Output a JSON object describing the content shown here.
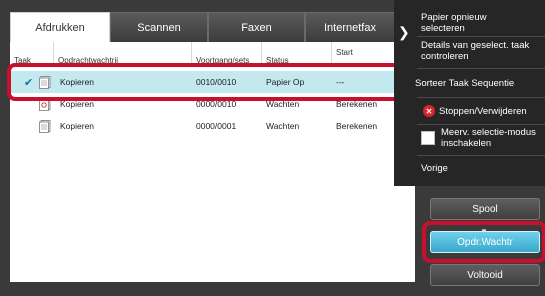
{
  "tabs": [
    {
      "label": "Afdrukken",
      "active": true
    },
    {
      "label": "Scannen",
      "active": false
    },
    {
      "label": "Faxen",
      "active": false
    },
    {
      "label": "Internetfax",
      "active": false
    }
  ],
  "table": {
    "columns": [
      "Taak",
      "Opdrachtwachtrij",
      "Voortgang/sets",
      "Status",
      "Start"
    ],
    "rows": [
      {
        "selected": true,
        "name": "Kopieren",
        "progress": "0010/0010",
        "status": "Papier Op",
        "start": "---",
        "icon": "copy-job-icon"
      },
      {
        "selected": false,
        "name": "Kopieren",
        "progress": "0000/0010",
        "status": "Wachten",
        "start": "Berekenen",
        "icon": "copy-job-icon"
      },
      {
        "selected": false,
        "name": "Kopieren",
        "progress": "0000/0001",
        "status": "Wachten",
        "start": "Berekenen",
        "icon": "copy-job-icon"
      }
    ]
  },
  "menu": {
    "items": [
      {
        "label": "Papier opnieuw selecteren"
      },
      {
        "label": "Details van geselect. taak controleren"
      },
      {
        "label": "Sorteer Taak Sequentie"
      },
      {
        "label": "Stoppen/Verwijderen",
        "icon": "stop-icon"
      },
      {
        "label": "Meerv. selectie-modus inschakelen",
        "icon": "checkbox-icon"
      },
      {
        "label": "Vorige"
      }
    ]
  },
  "side_buttons": {
    "spool": "Spool",
    "queue": "Opdr.Wachtr",
    "done": "Voltooid"
  },
  "colors": {
    "selected_row": "#c3e9ee",
    "highlight": "#c8102e",
    "active_button": "#3aa7cc"
  }
}
